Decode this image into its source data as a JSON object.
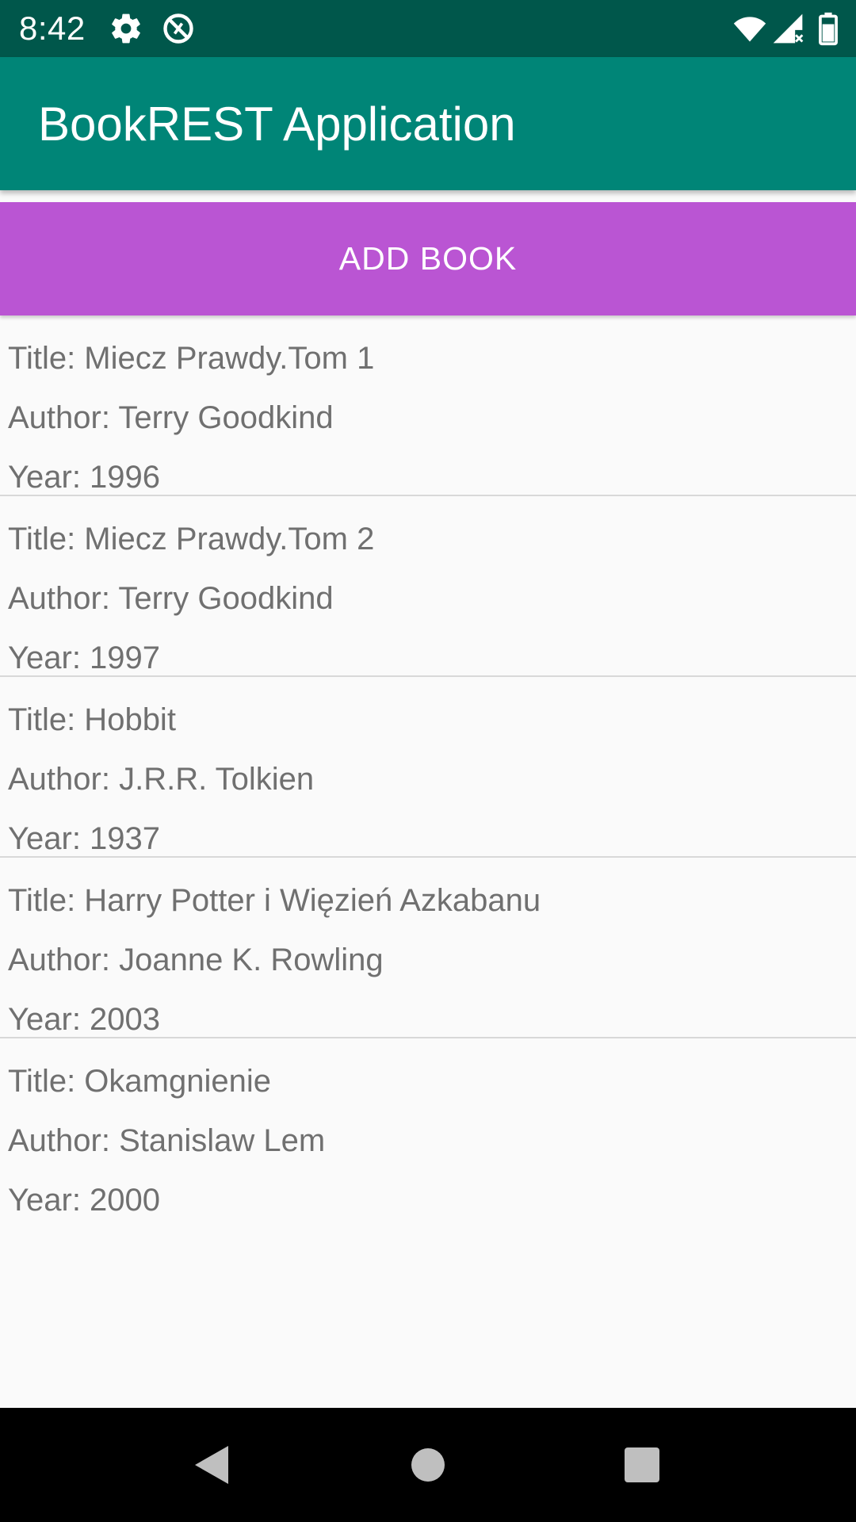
{
  "status_bar": {
    "time": "8:42",
    "icons": [
      "settings-icon",
      "no-sync-icon",
      "wifi-icon",
      "signal-icon",
      "battery-icon"
    ],
    "background": "#00574b"
  },
  "app_bar": {
    "title": "BookREST Application",
    "background": "#008577"
  },
  "add_button": {
    "label": "ADD BOOK",
    "background": "#ba55d3"
  },
  "books": [
    {
      "title": "Title: Miecz Prawdy.Tom 1",
      "author": "Author: Terry Goodkind",
      "year": "Year: 1996"
    },
    {
      "title": "Title: Miecz Prawdy.Tom 2",
      "author": "Author: Terry Goodkind",
      "year": "Year: 1997"
    },
    {
      "title": "Title: Hobbit",
      "author": "Author: J.R.R. Tolkien",
      "year": "Year: 1937"
    },
    {
      "title": "Title: Harry Potter i Więzień Azkabanu",
      "author": "Author: Joanne K. Rowling",
      "year": "Year: 2003"
    },
    {
      "title": "Title: Okamgnienie",
      "author": "Author: Stanislaw Lem",
      "year": "Year: 2000"
    }
  ],
  "nav_bar": {
    "buttons": [
      "back-icon",
      "home-icon",
      "recents-icon"
    ]
  }
}
